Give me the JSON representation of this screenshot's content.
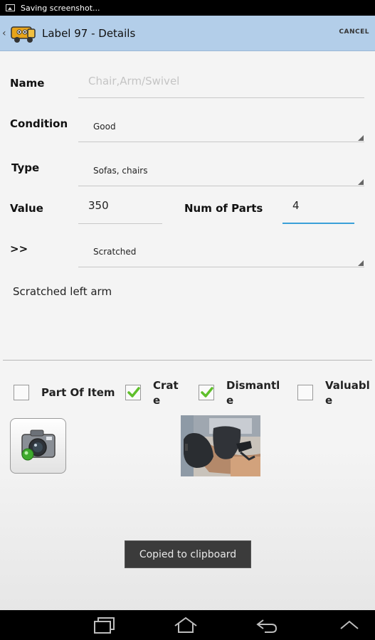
{
  "status_bar": {
    "notification_text": "Saving screenshot..."
  },
  "action_bar": {
    "title": "Label 97 - Details",
    "cancel_label": "CANCEL"
  },
  "form": {
    "name": {
      "label": "Name",
      "placeholder": "Chair,Arm/Swivel"
    },
    "condition": {
      "label": "Condition",
      "value": "Good"
    },
    "type": {
      "label": "Type",
      "value": "Sofas, chairs"
    },
    "value": {
      "label": "Value",
      "value": "350"
    },
    "num_parts": {
      "label": "Num of Parts",
      "value": "4"
    },
    "damage": {
      "label": ">>",
      "value": "Scratched"
    },
    "notes": "Scratched left arm"
  },
  "checkboxes": [
    {
      "label": "Part Of Item",
      "checked": false
    },
    {
      "label_line1": "Crat",
      "label_line2": "e",
      "checked": true
    },
    {
      "label_line1": "Dismantl",
      "label_line2": "e",
      "checked": true
    },
    {
      "label_line1": "Valuabl",
      "label_line2": "e",
      "checked": false
    }
  ],
  "toast": "Copied to clipboard",
  "icons": {
    "notification": "image-icon",
    "app": "truck-icon",
    "camera": "camera-icon",
    "nav": [
      "recent-apps-icon",
      "home-icon",
      "back-icon",
      "collapse-icon"
    ]
  },
  "colors": {
    "action_bar": "#b3cee9",
    "check_green": "#5fbf2b"
  }
}
